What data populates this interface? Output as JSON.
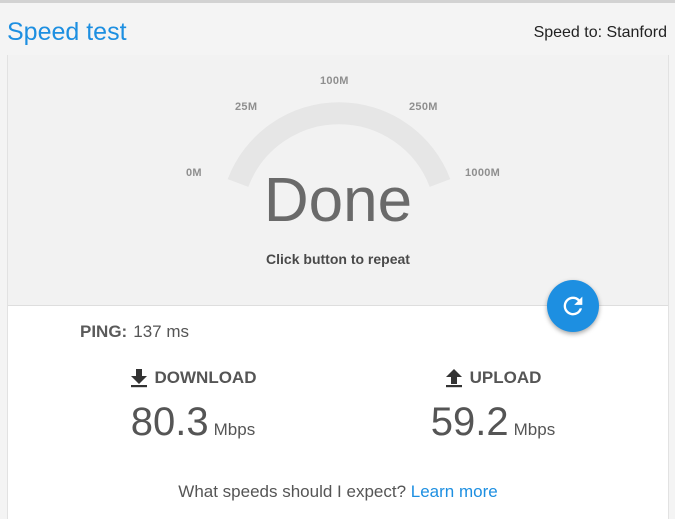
{
  "header": {
    "title": "Speed test",
    "speed_to": "Speed to: Stanford"
  },
  "gauge": {
    "ticks": [
      "0M",
      "25M",
      "100M",
      "250M",
      "1000M"
    ],
    "status": "Done",
    "hint": "Click button to repeat"
  },
  "ping": {
    "label": "PING:",
    "value": "137 ms"
  },
  "download": {
    "label": "DOWNLOAD",
    "value": "80.3",
    "unit": "Mbps"
  },
  "upload": {
    "label": "UPLOAD",
    "value": "59.2",
    "unit": "Mbps"
  },
  "footer": {
    "question": "What speeds should I expect?",
    "link": "Learn more"
  },
  "colors": {
    "accent": "#1d8fe1",
    "gauge_track": "#e6e6e6"
  },
  "icons": [
    "refresh-icon",
    "download-icon",
    "upload-icon"
  ]
}
